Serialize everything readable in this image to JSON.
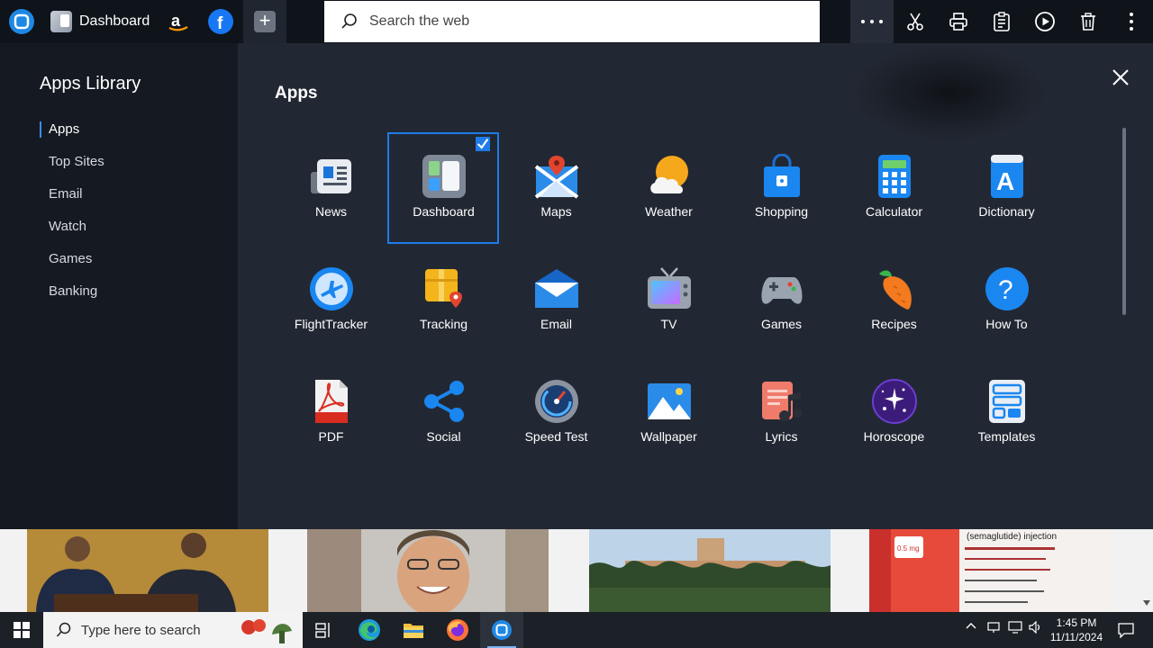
{
  "tabbar": {
    "dashboard_tab": "Dashboard"
  },
  "search": {
    "placeholder": "Search the web"
  },
  "library": {
    "title": "Apps Library",
    "nav": [
      {
        "label": "Apps",
        "selected": true
      },
      {
        "label": "Top Sites"
      },
      {
        "label": "Email"
      },
      {
        "label": "Watch"
      },
      {
        "label": "Games"
      },
      {
        "label": "Banking"
      }
    ]
  },
  "apps_section": {
    "heading": "Apps",
    "apps": [
      {
        "label": "News",
        "icon": "news-icon"
      },
      {
        "label": "Dashboard",
        "icon": "dashboard-icon",
        "selected": true
      },
      {
        "label": "Maps",
        "icon": "maps-icon"
      },
      {
        "label": "Weather",
        "icon": "weather-icon"
      },
      {
        "label": "Shopping",
        "icon": "shopping-icon"
      },
      {
        "label": "Calculator",
        "icon": "calculator-icon"
      },
      {
        "label": "Dictionary",
        "icon": "dictionary-icon"
      },
      {
        "label": "FlightTracker",
        "icon": "flight-tracker-icon"
      },
      {
        "label": "Tracking",
        "icon": "tracking-icon"
      },
      {
        "label": "Email",
        "icon": "email-icon"
      },
      {
        "label": "TV",
        "icon": "tv-icon"
      },
      {
        "label": "Games",
        "icon": "games-icon"
      },
      {
        "label": "Recipes",
        "icon": "recipes-icon"
      },
      {
        "label": "How To",
        "icon": "how-to-icon"
      },
      {
        "label": "PDF",
        "icon": "pdf-icon"
      },
      {
        "label": "Social",
        "icon": "social-icon"
      },
      {
        "label": "Speed Test",
        "icon": "speed-test-icon"
      },
      {
        "label": "Wallpaper",
        "icon": "wallpaper-icon"
      },
      {
        "label": "Lyrics",
        "icon": "lyrics-icon"
      },
      {
        "label": "Horoscope",
        "icon": "horoscope-icon"
      },
      {
        "label": "Templates",
        "icon": "templates-icon"
      }
    ]
  },
  "news_cards": {
    "card4_caption": "(semaglutide) injection"
  },
  "taskbar": {
    "search_placeholder": "Type here to search",
    "time": "1:45 PM",
    "date": "11/11/2024"
  },
  "colors": {
    "accent": "#1e7be8",
    "panel": "#222833",
    "sidebar": "#151a22"
  }
}
